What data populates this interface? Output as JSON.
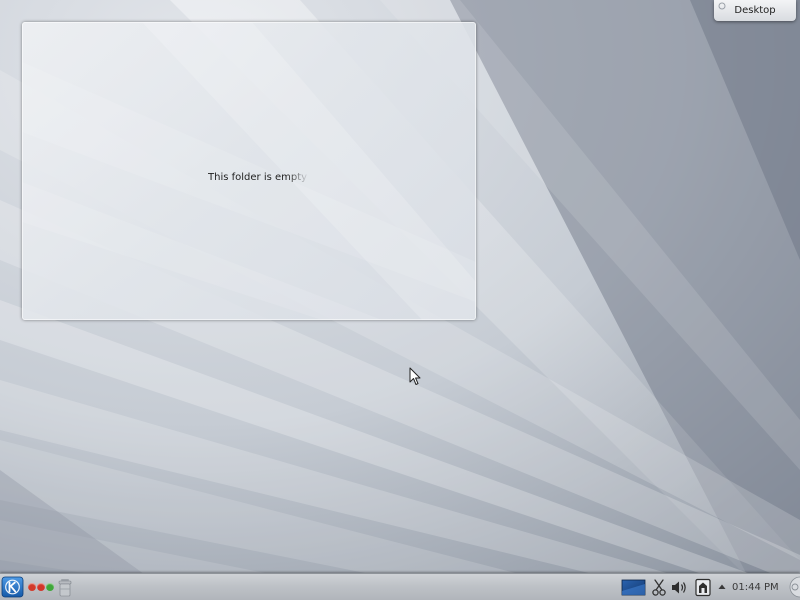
{
  "desktop": {
    "toolbox_label": "Desktop"
  },
  "folder_view": {
    "empty_message": "This folder is empty"
  },
  "panel": {
    "pager_colors": [
      "#d23a2a",
      "#d2352a",
      "#3fa73a"
    ],
    "clock": "01:44 PM",
    "tray_icons": [
      "show-desktop-icon",
      "scissors-icon",
      "volume-icon",
      "device-notifier-icon",
      "tray-expand-arrow-icon"
    ]
  },
  "colors": {
    "kde_blue": "#1c6fc4",
    "panel": "#bec2c7"
  }
}
